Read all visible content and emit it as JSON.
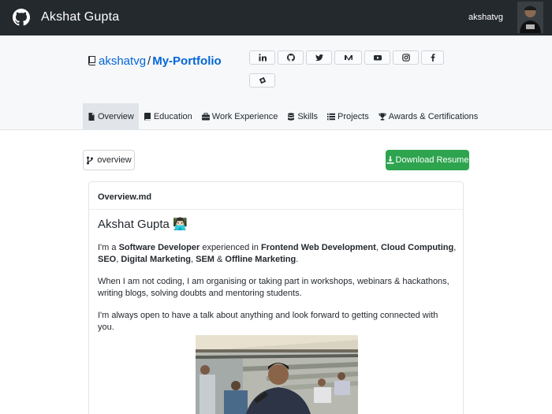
{
  "topbar": {
    "title": "Akshat Gupta",
    "username": "akshatvg",
    "logo_icon": "github-icon",
    "avatar_icon": "avatar-image"
  },
  "repo": {
    "owner": "akshatvg",
    "separator": "/",
    "name": "My-Portfolio",
    "icon": "repo-icon"
  },
  "social_links": [
    {
      "name": "linkedin-icon"
    },
    {
      "name": "github-icon"
    },
    {
      "name": "twitter-icon"
    },
    {
      "name": "medium-icon"
    },
    {
      "name": "youtube-icon"
    },
    {
      "name": "instagram-icon"
    },
    {
      "name": "facebook-icon"
    },
    {
      "name": "hashnode-icon"
    }
  ],
  "tabs": [
    {
      "label": "Overview",
      "icon": "file-icon",
      "active": true
    },
    {
      "label": "Education",
      "icon": "book-icon",
      "active": false
    },
    {
      "label": "Work Experience",
      "icon": "briefcase-icon",
      "active": false
    },
    {
      "label": "Skills",
      "icon": "database-icon",
      "active": false
    },
    {
      "label": "Projects",
      "icon": "tasks-icon",
      "active": false
    },
    {
      "label": "Awards & Certifications",
      "icon": "trophy-icon",
      "active": false
    }
  ],
  "branch": {
    "label": "overview",
    "icon": "branch-icon"
  },
  "download": {
    "label": "Download Resume",
    "icon": "download-icon",
    "color": "#2ea44f"
  },
  "readme": {
    "filename": "Overview.md",
    "heading": "Akshat Gupta 👨🏻‍💻",
    "intro": {
      "t1": "I'm a ",
      "b1": "Software Developer",
      "t2": " experienced in ",
      "b2": "Frontend Web Development",
      "t3": ", ",
      "b3": "Cloud Computing",
      "t4": ", ",
      "b4": "SEO",
      "t5": ", ",
      "b5": "Digital Marketing",
      "t6": ", ",
      "b6": "SEM",
      "t7": " & ",
      "b7": "Offline Marketing",
      "t8": "."
    },
    "para2": "When I am not coding, I am organising or taking part in workshops, webinars & hackathons, writing blogs, solving doubts and mentoring students.",
    "para3": "I'm always open to have a talk about anything and look forward to getting connected with you."
  },
  "colors": {
    "topbar": "#24292e",
    "link": "#0366d6",
    "band": "#f6f8fa",
    "success": "#2ea44f"
  }
}
